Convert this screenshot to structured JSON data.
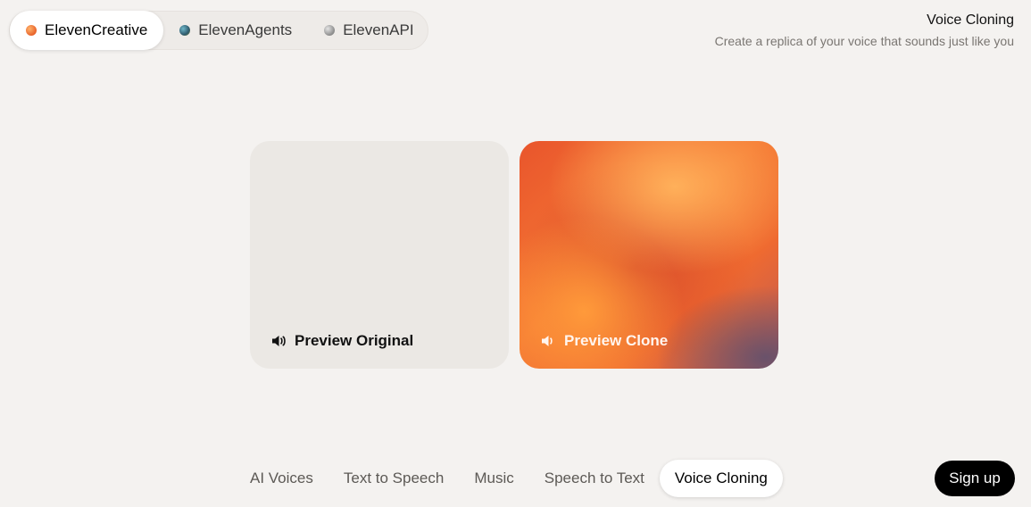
{
  "products": [
    {
      "label": "ElevenCreative",
      "dot": "creative",
      "active": true
    },
    {
      "label": "ElevenAgents",
      "dot": "agents",
      "active": false
    },
    {
      "label": "ElevenAPI",
      "dot": "api",
      "active": false
    }
  ],
  "header": {
    "title": "Voice Cloning",
    "subtitle": "Create a replica of your voice that sounds just like you"
  },
  "cards": {
    "original": {
      "label": "Preview Original",
      "icon": "speaker-icon"
    },
    "clone": {
      "label": "Preview Clone",
      "icon": "speaker-icon"
    }
  },
  "nav": [
    {
      "label": "AI Voices",
      "active": false
    },
    {
      "label": "Text to Speech",
      "active": false
    },
    {
      "label": "Music",
      "active": false
    },
    {
      "label": "Speech to Text",
      "active": false
    },
    {
      "label": "Voice Cloning",
      "active": true
    }
  ],
  "signup": {
    "label": "Sign up"
  },
  "colors": {
    "background": "#f4f2f0",
    "accent_orange": "#f57a34",
    "button_dark": "#000000"
  }
}
